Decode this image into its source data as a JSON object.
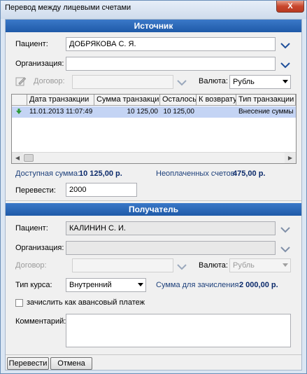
{
  "window": {
    "title": "Перевод между лицевыми счетами",
    "close_label": "X"
  },
  "source": {
    "header": "Источник",
    "patient_label": "Пациент:",
    "patient_value": "ДОБРЯКОВА С. Я.",
    "org_label": "Организация:",
    "org_value": "",
    "contract_label": "Договор:",
    "contract_value": "",
    "currency_label": "Валюта:",
    "currency_value": "Рубль",
    "table": {
      "columns": [
        "Дата транзакции",
        "Сумма транзакции",
        "Осталось",
        "К возврату",
        "Тип транзакции"
      ],
      "rows": [
        {
          "date": "11.01.2013 11:07:49",
          "amount": "10 125,00",
          "remaining": "10 125,00",
          "refund": "",
          "type": "Внесение суммы на ..."
        }
      ]
    },
    "available_label": "Доступная сумма:",
    "available_value": "10 125,00 р.",
    "unpaid_label": "Неоплаченных счетов:",
    "unpaid_value": "475,00 р.",
    "transfer_label": "Перевести:",
    "transfer_value": "2000"
  },
  "dest": {
    "header": "Получатель",
    "patient_label": "Пациент:",
    "patient_value": "КАЛИНИН С. И.",
    "org_label": "Организация:",
    "org_value": "",
    "contract_label": "Договор:",
    "contract_value": "",
    "currency_label": "Валюта:",
    "currency_value": "Рубль",
    "rate_label": "Тип курса:",
    "rate_value": "Внутренний",
    "credit_label": "Сумма для зачисления:",
    "credit_value": "2 000,00 р.",
    "advance_label": "зачислить как авансовый платеж",
    "comment_label": "Комментарий:",
    "comment_value": ""
  },
  "footer": {
    "transfer_button": "Перевести",
    "cancel_button": "Отмена"
  },
  "icons": {
    "chevron": "chevron-down-icon",
    "row_marker": "green-arrow-icon",
    "contract_picker": "pencil-icon"
  }
}
